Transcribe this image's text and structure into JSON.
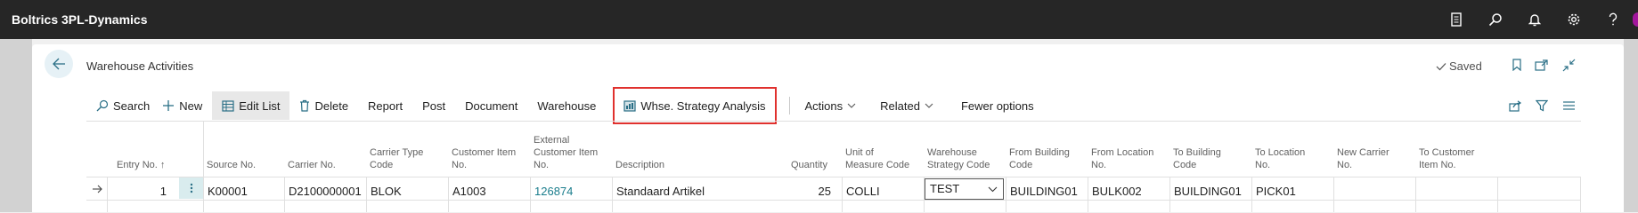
{
  "app": {
    "title": "Boltrics 3PL-Dynamics"
  },
  "top_icons": [
    "document-icon",
    "search-icon",
    "bell-icon",
    "gear-icon",
    "help-icon"
  ],
  "page": {
    "title": "Warehouse Activities",
    "saved_label": "Saved"
  },
  "actions": {
    "search": "Search",
    "new": "New",
    "edit_list": "Edit List",
    "delete": "Delete",
    "report": "Report",
    "post": "Post",
    "document": "Document",
    "warehouse": "Warehouse",
    "whse_strategy": "Whse. Strategy Analysis",
    "actions_menu": "Actions",
    "related": "Related",
    "fewer_options": "Fewer options"
  },
  "columns": {
    "entry_no": "Entry No.",
    "sort_arrow": "↑",
    "source_no": "Source No.",
    "carrier_no": "Carrier No.",
    "carrier_type_code_1": "Carrier Type",
    "carrier_type_code_2": "Code",
    "customer_item_no_1": "Customer Item",
    "customer_item_no_2": "No.",
    "ext_item_no_1": "External",
    "ext_item_no_2": "Customer Item",
    "ext_item_no_3": "No.",
    "description": "Description",
    "quantity": "Quantity",
    "uom_1": "Unit of",
    "uom_2": "Measure Code",
    "strategy_1": "Warehouse",
    "strategy_2": "Strategy Code",
    "from_building_1": "From Building",
    "from_building_2": "Code",
    "from_location_1": "From Location",
    "from_location_2": "No.",
    "to_building_1": "To Building",
    "to_building_2": "Code",
    "to_location_1": "To Location",
    "to_location_2": "No.",
    "new_carrier_1": "New Carrier",
    "new_carrier_2": "No.",
    "to_customer_1": "To Customer",
    "to_customer_2": "Item No."
  },
  "row": {
    "entry_no": "1",
    "source_no": "K00001",
    "carrier_no": "D2100000001",
    "carrier_type_code": "BLOK",
    "customer_item_no": "A1003",
    "ext_item_no": "126874",
    "description": "Standaard Artikel",
    "quantity": "25",
    "uom": "COLLI",
    "strategy_code": "TEST",
    "from_building": "BUILDING01",
    "from_location": "BULK002",
    "to_building": "BUILDING01",
    "to_location": "PICK01",
    "new_carrier": "",
    "to_customer_item": ""
  },
  "colors": {
    "topbar": "#262626",
    "accent": "#1a7d8c",
    "highlight_border": "#e0312e"
  }
}
